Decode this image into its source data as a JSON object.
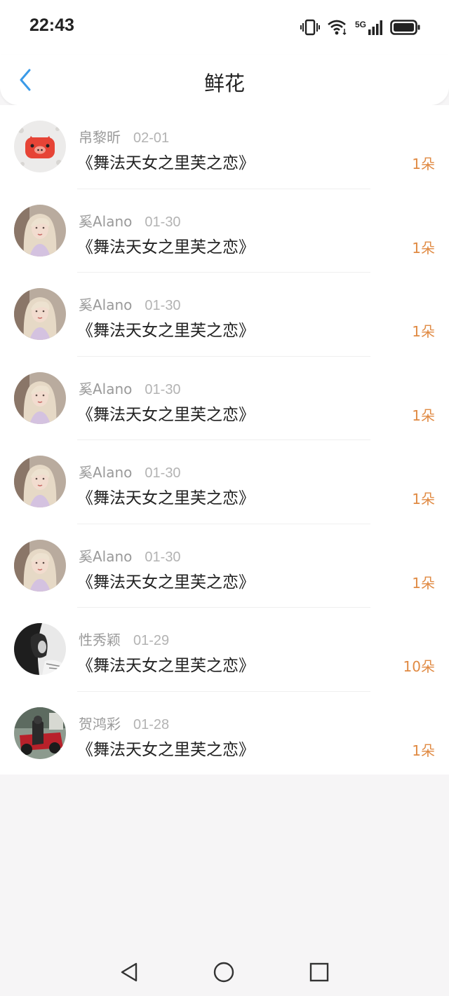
{
  "status_bar": {
    "time": "22:43",
    "network": "5G",
    "icons": [
      "vibrate-icon",
      "wifi-icon",
      "signal-icon",
      "battery-icon"
    ]
  },
  "nav": {
    "title": "鲜花",
    "back_icon": "chevron-left-icon",
    "accent_color": "#3a9ae8"
  },
  "colors": {
    "count_color": "#e08a43",
    "name_color": "#9a9a9a",
    "title_color": "#222222"
  },
  "records": [
    {
      "user": "帛黎昕",
      "date": "02-01",
      "book": "《舞法天女之里芙之恋》",
      "count": "1朵",
      "avatar": "pig-sticker-avatar"
    },
    {
      "user": "奚Alano",
      "date": "01-30",
      "book": "《舞法天女之里芙之恋》",
      "count": "1朵",
      "avatar": "blonde-girl-avatar"
    },
    {
      "user": "奚Alano",
      "date": "01-30",
      "book": "《舞法天女之里芙之恋》",
      "count": "1朵",
      "avatar": "blonde-girl-avatar"
    },
    {
      "user": "奚Alano",
      "date": "01-30",
      "book": "《舞法天女之里芙之恋》",
      "count": "1朵",
      "avatar": "blonde-girl-avatar"
    },
    {
      "user": "奚Alano",
      "date": "01-30",
      "book": "《舞法天女之里芙之恋》",
      "count": "1朵",
      "avatar": "blonde-girl-avatar"
    },
    {
      "user": "奚Alano",
      "date": "01-30",
      "book": "《舞法天女之里芙之恋》",
      "count": "1朵",
      "avatar": "blonde-girl-avatar"
    },
    {
      "user": "性秀颖",
      "date": "01-29",
      "book": "《舞法天女之里芙之恋》",
      "count": "10朵",
      "avatar": "monochrome-girl-avatar"
    },
    {
      "user": "贺鸿彩",
      "date": "01-28",
      "book": "《舞法天女之里芙之恋》",
      "count": "1朵",
      "avatar": "motorcycle-rider-avatar"
    }
  ],
  "system_nav": {
    "back_icon": "triangle-back-icon",
    "home_icon": "circle-home-icon",
    "recents_icon": "square-recents-icon"
  }
}
